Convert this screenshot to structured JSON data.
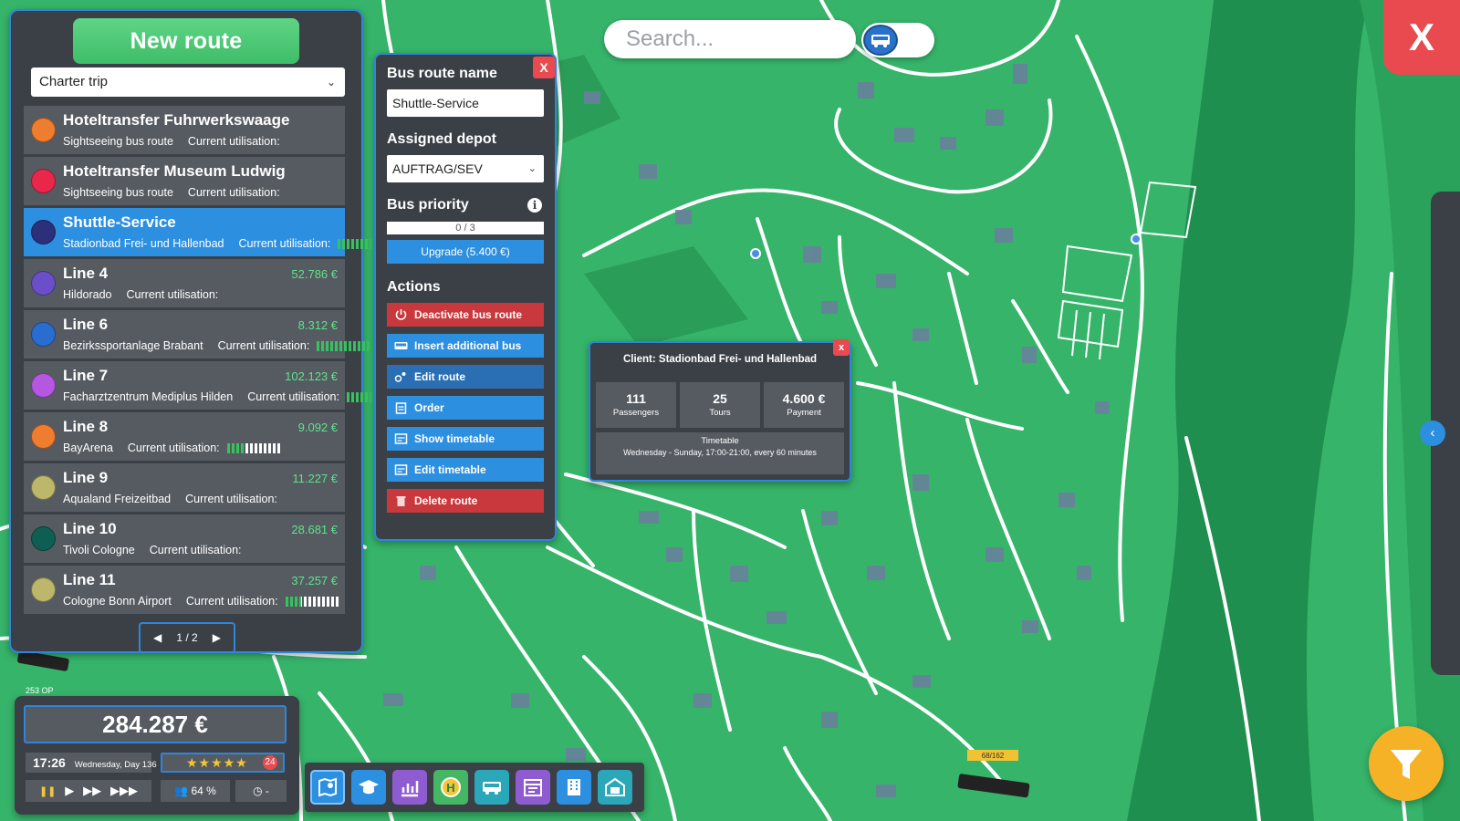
{
  "routes_panel": {
    "new_route_label": "New route",
    "filter_value": "Charter trip",
    "routes": [
      {
        "name": "Hoteltransfer Fuhrwerkswaage",
        "sub": "Sightseeing bus route",
        "util_label": "Current utilisation:",
        "value": "",
        "util": null,
        "color": "#ef7d2f",
        "selected": false
      },
      {
        "name": "Hoteltransfer Museum Ludwig",
        "sub": "Sightseeing bus route",
        "util_label": "Current utilisation:",
        "value": "",
        "util": null,
        "color": "#e8274b",
        "selected": false
      },
      {
        "name": "Shuttle-Service",
        "sub": "Stadionbad Frei- und Hallenbad",
        "util_label": "Current utilisation:",
        "value": "",
        "util": 1.0,
        "color": "#2c2f7a",
        "selected": true
      },
      {
        "name": "Line 4",
        "sub": "Hildorado",
        "util_label": "Current utilisation:",
        "value": "52.786 €",
        "util": null,
        "color": "#6a4fc9",
        "selected": false
      },
      {
        "name": "Line 6",
        "sub": "Bezirkssportanlage Brabant",
        "util_label": "Current utilisation:",
        "value": "8.312 €",
        "util": 1.0,
        "color": "#2a6dd1",
        "selected": false
      },
      {
        "name": "Line 7",
        "sub": "Facharztzentrum Mediplus Hilden",
        "util_label": "Current utilisation:",
        "value": "102.123 €",
        "util": 1.0,
        "color": "#b557e0",
        "selected": false
      },
      {
        "name": "Line 8",
        "sub": "BayArena",
        "util_label": "Current utilisation:",
        "value": "9.092 €",
        "util": 0.35,
        "color": "#ef7d2f",
        "selected": false
      },
      {
        "name": "Line 9",
        "sub": "Aqualand Freizeitbad",
        "util_label": "Current utilisation:",
        "value": "11.227 €",
        "util": null,
        "color": "#bdb76b",
        "selected": false
      },
      {
        "name": "Line 10",
        "sub": "Tivoli Cologne",
        "util_label": "Current utilisation:",
        "value": "28.681 €",
        "util": null,
        "color": "#0f5e54",
        "selected": false
      },
      {
        "name": "Line 11",
        "sub": "Cologne Bonn Airport",
        "util_label": "Current utilisation:",
        "value": "37.257 €",
        "util": 0.3,
        "color": "#bdb76b",
        "selected": false
      }
    ],
    "pager": {
      "prev": "◀",
      "label": "1 / 2",
      "next": "▶"
    }
  },
  "details": {
    "close_label": "X",
    "name_label": "Bus route name",
    "name_value": "Shuttle-Service",
    "depot_label": "Assigned depot",
    "depot_value": "AUFTRAG/SEV",
    "priority_label": "Bus priority",
    "info_label": "i",
    "priority_value": "0 / 3",
    "upgrade_label": "Upgrade (5.400 €)",
    "actions_label": "Actions",
    "actions": [
      {
        "label": "Deactivate bus route",
        "style": "red",
        "icon": "power-icon"
      },
      {
        "label": "Insert additional bus",
        "style": "blue",
        "icon": "bus-icon"
      },
      {
        "label": "Edit route",
        "style": "darkblue",
        "icon": "route-edit-icon"
      },
      {
        "label": "Order",
        "style": "blue",
        "icon": "clipboard-icon"
      },
      {
        "label": "Show timetable",
        "style": "blue",
        "icon": "timetable-icon"
      },
      {
        "label": "Edit timetable",
        "style": "blue",
        "icon": "timetable-edit-icon"
      },
      {
        "label": "Delete route",
        "style": "red",
        "icon": "trash-icon"
      }
    ]
  },
  "client_popup": {
    "close_label": "x",
    "title": "Client: Stadionbad Frei- und Hallenbad",
    "stats": [
      {
        "value": "111",
        "label": "Passengers"
      },
      {
        "value": "25",
        "label": "Tours"
      },
      {
        "value": "4.600 €",
        "label": "Payment"
      }
    ],
    "timetable_label": "Timetable",
    "timetable_desc": "Wednesday - Sunday, 17:00-21:00, every 60 minutes"
  },
  "search": {
    "placeholder": "Search..."
  },
  "close_x_label": "X",
  "collapse_label": "‹",
  "status": {
    "money": "284.287 €",
    "time": "17:26",
    "day": "Wednesday, Day 136",
    "stars": "★★★★★",
    "rating_count": "24",
    "speed": {
      "pause": "❚❚",
      "play": "▶",
      "fast": "▶▶",
      "fastest": "▶▶▶"
    },
    "passengers": "64 %",
    "clock_value": "-"
  },
  "map_labels": {
    "stop_label": "253 OP",
    "bus_count": "68/162"
  },
  "colors": {
    "map_green": "#36b46a",
    "panel": "#3b4047",
    "accent": "#2f86d9",
    "alert": "#e84a4f"
  }
}
